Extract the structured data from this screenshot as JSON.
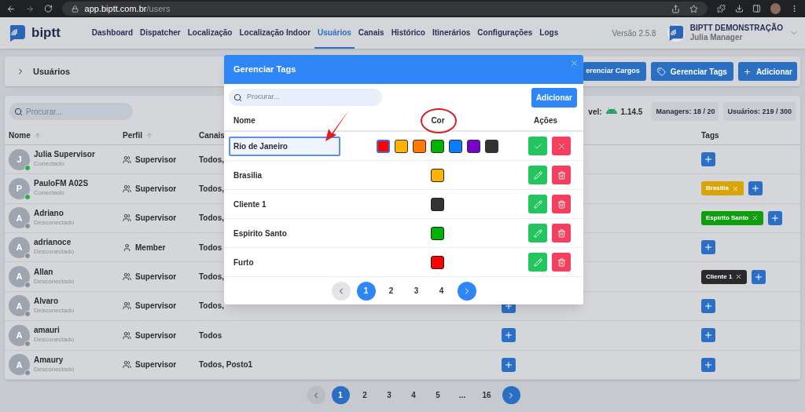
{
  "browser": {
    "url_host": "app.biptt.com.br",
    "url_path": "/users"
  },
  "nav": {
    "brand": "biptt",
    "items": [
      {
        "label": "Dashboard",
        "selected": false
      },
      {
        "label": "Dispatcher",
        "selected": false
      },
      {
        "label": "Localização",
        "selected": false
      },
      {
        "label": "Localização Indoor",
        "selected": false
      },
      {
        "label": "Usuários",
        "selected": true
      },
      {
        "label": "Canais",
        "selected": false
      },
      {
        "label": "Histórico",
        "selected": false
      },
      {
        "label": "Itinerários",
        "selected": false
      },
      {
        "label": "Configurações",
        "selected": false
      },
      {
        "label": "Logs",
        "selected": false
      }
    ],
    "version": "Versão 2.5.8",
    "account": "BIPTT DEMONSTRAÇÃO",
    "user": "Julia Manager"
  },
  "header": {
    "title": "Usuários",
    "buttons": [
      {
        "label": "erenciar Cargos",
        "kind": "plain"
      },
      {
        "label": "Gerenciar Tags",
        "kind": "tag"
      },
      {
        "label": "Adicionar",
        "kind": "add"
      }
    ]
  },
  "stats": {
    "app_label": "vel:",
    "app_version": "1.14.5",
    "chips": [
      "Managers: 18 / 20",
      "Usuários: 219 / 300"
    ]
  },
  "search": {
    "placeholder": "Procurar..."
  },
  "table": {
    "columns": [
      "Nome",
      "Perfil",
      "Canais",
      "Tags"
    ],
    "rows": [
      {
        "initial": "J",
        "name": "Julia Supervisor",
        "status": "Conectado",
        "online": true,
        "role": "Supervisor",
        "kind": "group",
        "channels": "Todos,",
        "tags": []
      },
      {
        "initial": "P",
        "name": "PauloFM A02S",
        "status": "Conectado",
        "online": true,
        "role": "Supervisor",
        "kind": "group",
        "channels": "Todos,",
        "tags": [
          {
            "label": "Brasilia",
            "color": "#d9a406"
          }
        ]
      },
      {
        "initial": "A",
        "name": "Adriano",
        "status": "Desconectado",
        "online": false,
        "role": "Supervisor",
        "kind": "group",
        "channels": "Todos,",
        "tags": [
          {
            "label": "Espirito Santo",
            "color": "#0e9e0e"
          }
        ]
      },
      {
        "initial": "A",
        "name": "adrianoce",
        "status": "Desconectado",
        "online": false,
        "role": "Member",
        "kind": "person",
        "channels": "Todos",
        "tags": []
      },
      {
        "initial": "A",
        "name": "Allan",
        "status": "Desconectado",
        "online": false,
        "role": "Supervisor",
        "kind": "group",
        "channels": "Todos,",
        "tags": [
          {
            "label": "Cliente 1",
            "color": "#2a2a2a"
          }
        ]
      },
      {
        "initial": "A",
        "name": "Alvaro",
        "status": "Desconectado",
        "online": false,
        "role": "Supervisor",
        "kind": "group",
        "channels": "Todos,",
        "tags": []
      },
      {
        "initial": "A",
        "name": "amauri",
        "status": "Desconectado",
        "online": false,
        "role": "Supervisor",
        "kind": "group",
        "channels": "Todos",
        "tags": []
      },
      {
        "initial": "A",
        "name": "Amaury",
        "status": "Desconectado",
        "online": false,
        "role": "Supervisor",
        "kind": "group",
        "channels": "Todos, Posto1",
        "tags": []
      }
    ]
  },
  "pagination": [
    {
      "label": "1",
      "selected": true
    },
    {
      "label": "2",
      "selected": false
    },
    {
      "label": "3",
      "selected": false
    },
    {
      "label": "4",
      "selected": false
    },
    {
      "label": "5",
      "selected": false
    },
    {
      "label": "...",
      "selected": false
    },
    {
      "label": "16",
      "selected": false
    }
  ],
  "tag_modal": {
    "title": "Gerenciar Tags",
    "search": {
      "placeholder": "Procurar..."
    },
    "add_button": "Adicionar",
    "columns": [
      "Nome",
      "Cor",
      "Ações"
    ],
    "palette": [
      {
        "color": "#ff0000",
        "selected": true
      },
      {
        "color": "#ffb300",
        "selected": false
      },
      {
        "color": "#ff7a00",
        "selected": false
      },
      {
        "color": "#00b300",
        "selected": false
      },
      {
        "color": "#0a7cff",
        "selected": false
      },
      {
        "color": "#7a00cc",
        "selected": false
      },
      {
        "color": "#333333",
        "selected": false
      }
    ],
    "tags": [
      {
        "name": "Rio de Janeiro",
        "kind": "editing"
      },
      {
        "name": "Brasilia",
        "kind": "view",
        "color": "#ffb300"
      },
      {
        "name": "Cliente 1",
        "kind": "view",
        "color": "#333333"
      },
      {
        "name": "Espirito Santo",
        "kind": "view",
        "color": "#00b300"
      },
      {
        "name": "Furto",
        "kind": "view",
        "color": "#ff0000"
      }
    ],
    "pagination": [
      {
        "label": "1",
        "selected": true
      },
      {
        "label": "2",
        "selected": false
      },
      {
        "label": "3",
        "selected": false
      },
      {
        "label": "4",
        "selected": false
      }
    ]
  }
}
